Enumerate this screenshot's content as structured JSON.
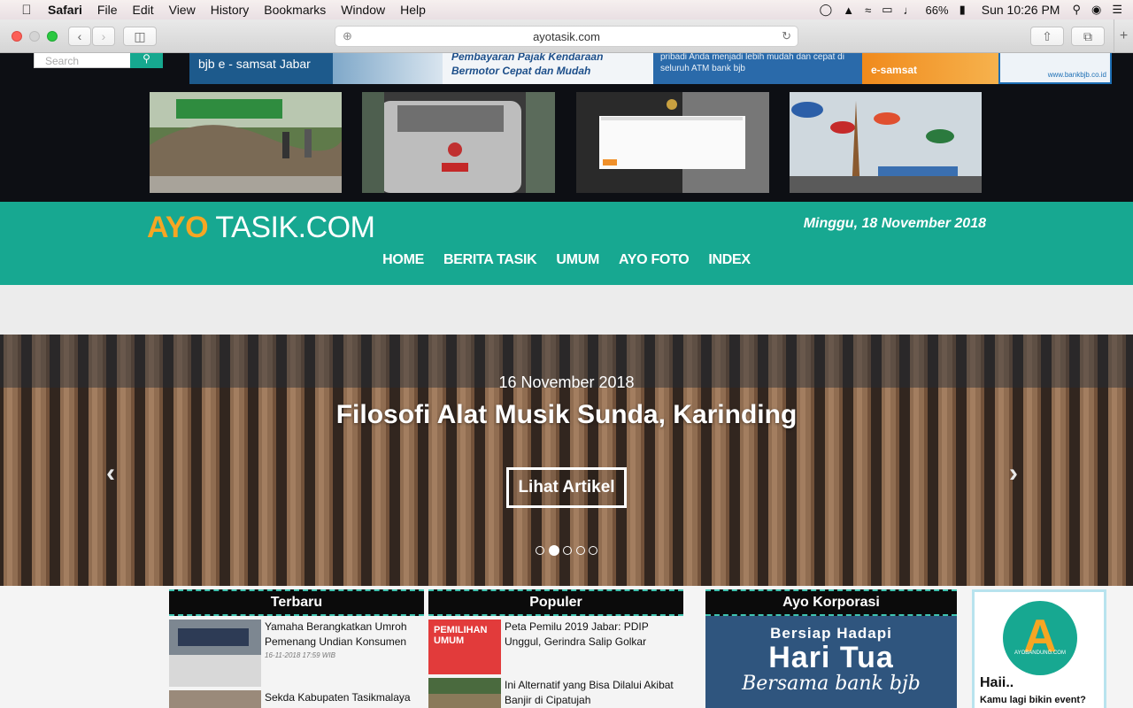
{
  "menubar": {
    "app": "Safari",
    "menus": [
      "File",
      "Edit",
      "View",
      "History",
      "Bookmarks",
      "Window",
      "Help"
    ],
    "battery": "66%",
    "clock": "Sun 10:26 PM"
  },
  "browser": {
    "url": "ayotasik.com"
  },
  "top": {
    "search_placeholder": "Search",
    "banner": {
      "b1": "bjb  e - samsat Jabar",
      "b3": "Pembayaran Pajak Kendaraan Bermotor Cepat dan Mudah",
      "b4": "pribadi Anda menjadi lebih mudah dan cepat di seluruh ATM bank bjb",
      "b5": "e-samsat",
      "b6": "www.bankbjb.co.id"
    }
  },
  "header": {
    "logo_ayo": "AYO",
    "logo_rest": " TASIK.COM",
    "date": "Minggu, 18 November 2018",
    "nav": [
      "HOME",
      "BERITA TASIK",
      "UMUM",
      "AYO FOTO",
      "INDEX"
    ]
  },
  "hero": {
    "date": "16 November 2018",
    "title": "Filosofi Alat Musik Sunda, Karinding",
    "button": "Lihat Artikel",
    "prev": "‹",
    "next": "›",
    "active_slide": 2,
    "slide_count": 5
  },
  "columns": {
    "terbaru": {
      "heading": "Terbaru",
      "items": [
        {
          "title": "Yamaha Berangkatkan Umroh Pemenang Undian Konsumen",
          "meta": "16-11-2018 17:59 WIB"
        },
        {
          "title": "Sekda Kabupaten Tasikmalaya",
          "meta": ""
        }
      ]
    },
    "populer": {
      "heading": "Populer",
      "items": [
        {
          "title": "Peta Pemilu 2019 Jabar: PDIP Unggul, Gerindra Salip Golkar",
          "img_label": "PEMILIHAN UMUM"
        },
        {
          "title": "Ini Alternatif yang Bisa Dilalui Akibat Banjir di Cipatujah",
          "img_label": ""
        }
      ]
    },
    "korporasi": {
      "heading": "Ayo Korporasi",
      "line1": "Bersiap Hadapi",
      "line2": "Hari Tua",
      "line3": "Bersama bank bjb"
    },
    "ad": {
      "logo_letter": "A",
      "logo_caption": "AYOBANDUNG.COM",
      "heading": "Haii..",
      "sub": "Kamu lagi bikin event?"
    }
  },
  "colors": {
    "teal": "#17a891",
    "orange": "#f6a623",
    "dark": "#0d0f14"
  }
}
